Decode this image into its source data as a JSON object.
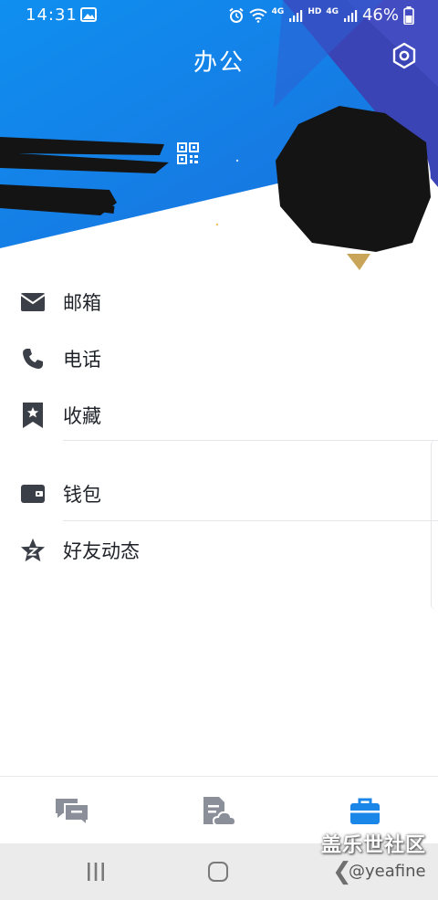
{
  "status_bar": {
    "time": "14:31",
    "network_small_1": "4G",
    "hd": "HD",
    "network_small_2": "4G",
    "battery": "46%"
  },
  "header": {
    "title": "办公"
  },
  "menu": {
    "items": [
      {
        "label": "邮箱",
        "icon": "mail-icon"
      },
      {
        "label": "电话",
        "icon": "phone-icon"
      },
      {
        "label": "收藏",
        "icon": "bookmark-star-icon"
      },
      {
        "label": "钱包",
        "icon": "wallet-icon"
      },
      {
        "label": "好友动态",
        "icon": "friends-feed-star-icon"
      }
    ]
  },
  "tabs": [
    {
      "icon": "messages-icon",
      "active": false
    },
    {
      "icon": "docs-cloud-icon",
      "active": false
    },
    {
      "icon": "briefcase-icon",
      "active": true
    }
  ],
  "watermark": {
    "brand": "盖乐世社区",
    "handle": "@yeafine"
  },
  "colors": {
    "header_blue": "#1a86e8",
    "header_indigo": "#3d46b8",
    "active_tab": "#1a86e8",
    "icon_dark": "#3b3f47",
    "inactive_tab": "#8a8f99"
  }
}
